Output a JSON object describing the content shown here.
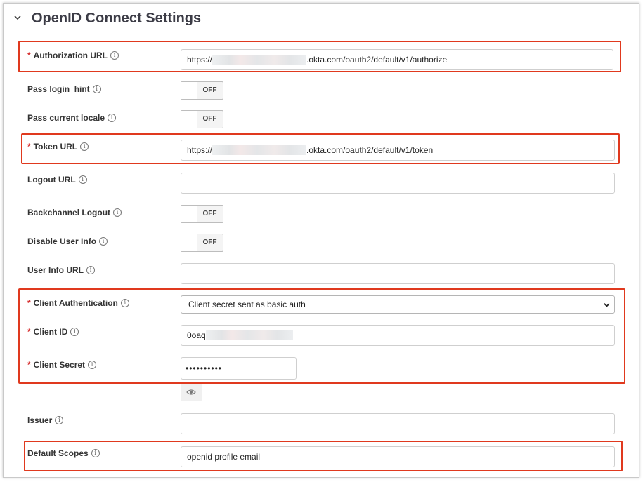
{
  "section": {
    "title": "OpenID Connect Settings"
  },
  "fields": {
    "authorization_url": {
      "label": "Authorization URL",
      "required": "*",
      "value_prefix": "https://",
      "value_suffix": ".okta.com/oauth2/default/v1/authorize"
    },
    "pass_login_hint": {
      "label": "Pass login_hint",
      "toggle": "OFF"
    },
    "pass_current_locale": {
      "label": "Pass current locale",
      "toggle": "OFF"
    },
    "token_url": {
      "label": "Token URL",
      "required": "*",
      "value_prefix": "https://",
      "value_suffix": ".okta.com/oauth2/default/v1/token"
    },
    "logout_url": {
      "label": "Logout URL",
      "value": ""
    },
    "backchannel_logout": {
      "label": "Backchannel Logout",
      "toggle": "OFF"
    },
    "disable_user_info": {
      "label": "Disable User Info",
      "toggle": "OFF"
    },
    "user_info_url": {
      "label": "User Info URL",
      "value": ""
    },
    "client_authentication": {
      "label": "Client Authentication",
      "required": "*",
      "selected": "Client secret sent as basic auth"
    },
    "client_id": {
      "label": "Client ID",
      "required": "*",
      "value_prefix": "0oaq"
    },
    "client_secret": {
      "label": "Client Secret",
      "required": "*",
      "value": "••••••••••"
    },
    "issuer": {
      "label": "Issuer",
      "value": ""
    },
    "default_scopes": {
      "label": "Default Scopes",
      "value": "openid profile email"
    }
  },
  "icons": {
    "info": "info-icon",
    "collapse": "chevron-down-icon",
    "reveal": "eye-icon",
    "dropdown": "caret-down-icon"
  },
  "colors": {
    "highlight": "#e0391e",
    "required": "#d62f2f",
    "title": "#3c3c46"
  }
}
